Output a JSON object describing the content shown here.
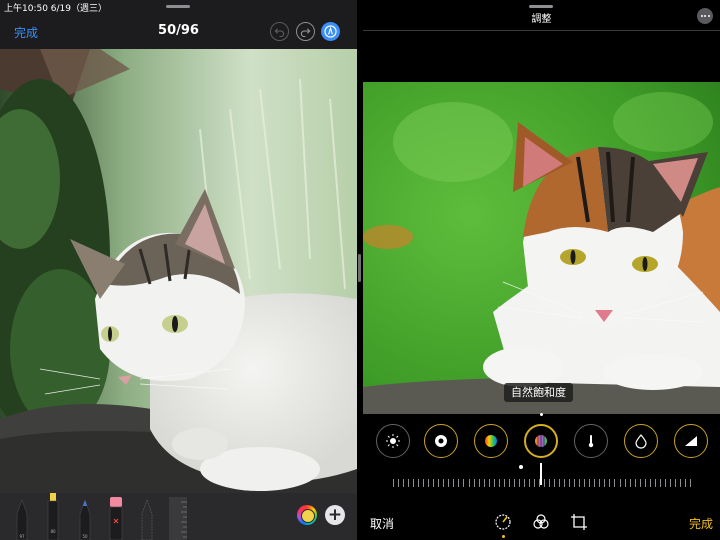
{
  "status_bar": {
    "time_date": "上午10:50  6/19（週三）"
  },
  "left_pane": {
    "done_label": "完成",
    "page_counter": "50/96",
    "pens": [
      {
        "name": "pen",
        "label": "97",
        "color": "#1c1c1e"
      },
      {
        "name": "highlighter",
        "label": "80",
        "color": "#f2d24a"
      },
      {
        "name": "pencil",
        "label": "50",
        "color": "#1e2a5a"
      },
      {
        "name": "eraser",
        "label": "",
        "color": "#f08aa0"
      },
      {
        "name": "lasso",
        "label": "",
        "color": "#3a3a3c"
      },
      {
        "name": "ruler",
        "label": "",
        "color": "#48484a"
      }
    ],
    "icons": {
      "undo": "undo-icon",
      "redo": "redo-icon",
      "markup": "markup-pen-icon",
      "color_picker": "color-wheel-icon",
      "add": "plus-icon"
    }
  },
  "right_pane": {
    "title": "調整",
    "current_adjustment": "自然飽和度",
    "cancel_label": "取消",
    "done_label": "完成",
    "tools": [
      {
        "name": "brilliance",
        "icon": "sun-dial-icon"
      },
      {
        "name": "black-point",
        "icon": "black-point-icon"
      },
      {
        "name": "saturation",
        "icon": "saturation-icon"
      },
      {
        "name": "vibrance",
        "icon": "vibrance-icon"
      },
      {
        "name": "warmth",
        "icon": "thermometer-icon"
      },
      {
        "name": "tint",
        "icon": "tint-drop-icon"
      },
      {
        "name": "sharpness",
        "icon": "sharpness-icon"
      }
    ],
    "selected_tool": "vibrance",
    "slider_value": 0,
    "bottom_tabs": [
      {
        "name": "adjust",
        "icon": "adjust-dial-icon"
      },
      {
        "name": "filters",
        "icon": "filters-icon"
      },
      {
        "name": "crop",
        "icon": "crop-icon"
      }
    ],
    "accent_color": "#f2c01e"
  },
  "colors": {
    "link_blue": "#3b8ff6",
    "markup_active": "#3b8ff6",
    "adjust_yellow": "#f2c01e"
  }
}
